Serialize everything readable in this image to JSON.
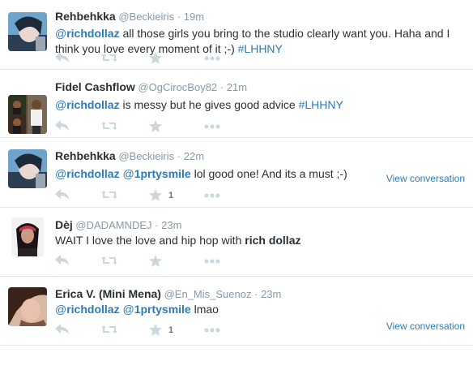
{
  "tweets": [
    {
      "name": "Rehbehkka",
      "handle": "@Beckieiris",
      "time": "19m",
      "parts": [
        {
          "t": "@",
          "c": "mention-at"
        },
        {
          "t": "richdollaz",
          "c": "mention-b"
        },
        {
          "t": " all those girls you bring to the studio clearly want you. Haha and I think you love every moment of it ;-) ",
          "c": "plain"
        },
        {
          "t": "#LHHNY",
          "c": "hashtag"
        }
      ],
      "fav_count": "",
      "view_conversation": ""
    },
    {
      "name": "Fidel Cashflow",
      "handle": "@OgCirocBoy82",
      "time": "21m",
      "parts": [
        {
          "t": "@",
          "c": "mention-at"
        },
        {
          "t": "richdollaz",
          "c": "mention-b"
        },
        {
          "t": " is messy but he gives good advice ",
          "c": "plain"
        },
        {
          "t": "#LHHNY",
          "c": "hashtag"
        }
      ],
      "fav_count": "",
      "view_conversation": ""
    },
    {
      "name": "Rehbehkka",
      "handle": "@Beckieiris",
      "time": "22m",
      "parts": [
        {
          "t": "@",
          "c": "mention-at"
        },
        {
          "t": "richdollaz",
          "c": "mention-b"
        },
        {
          "t": " ",
          "c": "plain"
        },
        {
          "t": "@",
          "c": "mention-at"
        },
        {
          "t": "1prtysmile",
          "c": "mention-b"
        },
        {
          "t": " lol good one! And its a must ;-)",
          "c": "plain"
        }
      ],
      "fav_count": "1",
      "view_conversation": "View conversation"
    },
    {
      "name": "Dèj",
      "handle": "@DADAMNDEJ",
      "time": "23m",
      "parts": [
        {
          "t": "WAIT  I love the love and hip hop with ",
          "c": "plain"
        },
        {
          "t": "rich dollaz",
          "c": "strong"
        }
      ],
      "fav_count": "",
      "view_conversation": ""
    },
    {
      "name": "Erica V. (Mini Mena)",
      "handle": "@En_Mis_Suenoz",
      "time": "23m",
      "parts": [
        {
          "t": "@",
          "c": "mention-at"
        },
        {
          "t": "richdollaz",
          "c": "mention-b"
        },
        {
          "t": " ",
          "c": "plain"
        },
        {
          "t": "@",
          "c": "mention-at"
        },
        {
          "t": "1prtysmile",
          "c": "mention-b"
        },
        {
          "t": " lmao",
          "c": "plain"
        }
      ],
      "fav_count": "1",
      "view_conversation": "View conversation"
    }
  ],
  "dot": "·",
  "icons": {
    "reply": "reply-icon",
    "retweet": "retweet-icon",
    "favorite": "star-icon",
    "more": "more-icon"
  },
  "colors": {
    "link": "#2b7bb9",
    "icon": "#ccd6dd",
    "muted": "#8899a6"
  }
}
